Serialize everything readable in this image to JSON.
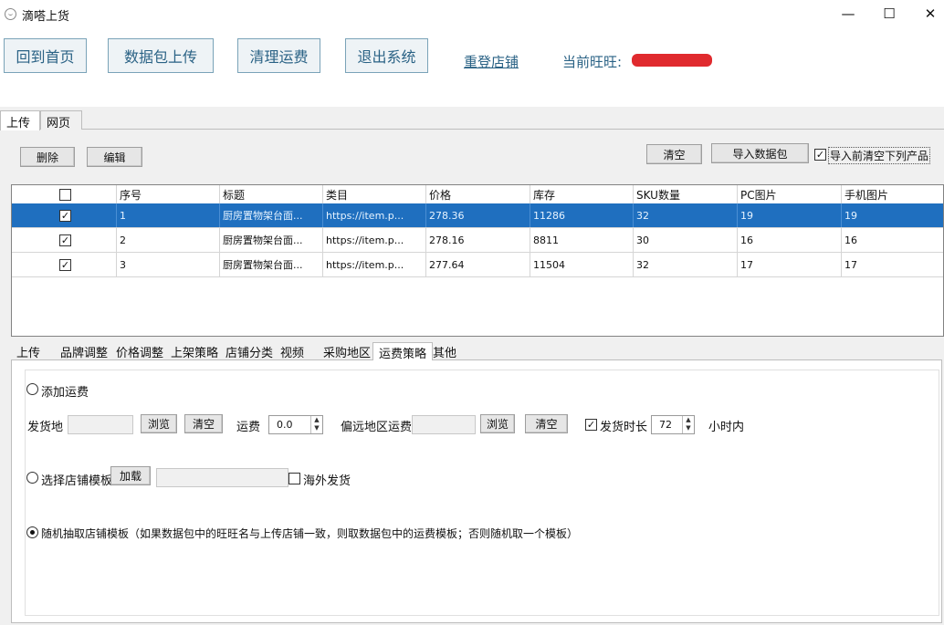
{
  "window": {
    "title": "滴嗒上货",
    "minimize": "—",
    "maximize": "☐",
    "close": "✕"
  },
  "toolbar": {
    "home": "回到首页",
    "upload_pkg": "数据包上传",
    "clear_freight": "清理运费",
    "exit": "退出系统",
    "relogin": "重登店铺",
    "current_wangwang_label": "当前旺旺:"
  },
  "main_tabs": [
    "上传",
    "网页"
  ],
  "actions": {
    "delete": "删除",
    "edit": "编辑",
    "clear": "清空",
    "import": "导入数据包",
    "clear_before_import": "导入前清空下列产品"
  },
  "grid": {
    "columns": [
      "序号",
      "标题",
      "类目",
      "价格",
      "库存",
      "SKU数量",
      "PC图片",
      "手机图片"
    ],
    "rows": [
      {
        "checked": "✓",
        "index": "1",
        "title": "厨房置物架台面...",
        "category": "https://item.p...",
        "price": "278.36",
        "stock": "11286",
        "sku": "32",
        "pc_img": "19",
        "mobile_img": "19"
      },
      {
        "checked": "✓",
        "index": "2",
        "title": "厨房置物架台面...",
        "category": "https://item.p...",
        "price": "278.16",
        "stock": "8811",
        "sku": "30",
        "pc_img": "16",
        "mobile_img": "16"
      },
      {
        "checked": "✓",
        "index": "3",
        "title": "厨房置物架台面...",
        "category": "https://item.p...",
        "price": "277.64",
        "stock": "11504",
        "sku": "32",
        "pc_img": "17",
        "mobile_img": "17"
      }
    ]
  },
  "sub_tabs": [
    "上传",
    "品牌调整",
    "价格调整",
    "上架策略",
    "店铺分类",
    "视频",
    "采购地区",
    "运费策略",
    "其他"
  ],
  "freight": {
    "add_freight": "添加运费",
    "ship_from": "发货地",
    "browse": "浏览",
    "clear": "清空",
    "freight_label": "运费",
    "freight_value": "0.0",
    "remote_freight": "偏远地区运费",
    "ship_time": "发货时长",
    "ship_time_value": "72",
    "hours_within": "小时内",
    "choose_template": "选择店铺模板",
    "load": "加载",
    "overseas": "海外发货",
    "random_template": "随机抽取店铺模板（如果数据包中的旺旺名与上传店铺一致，则取数据包中的运费模板；否则随机取一个模板）",
    "checked_mark": "✓"
  },
  "colors": {
    "selected_row": "#1f6fbf",
    "toolbar_text": "#2a6285",
    "redacted": "#e02a2e"
  }
}
